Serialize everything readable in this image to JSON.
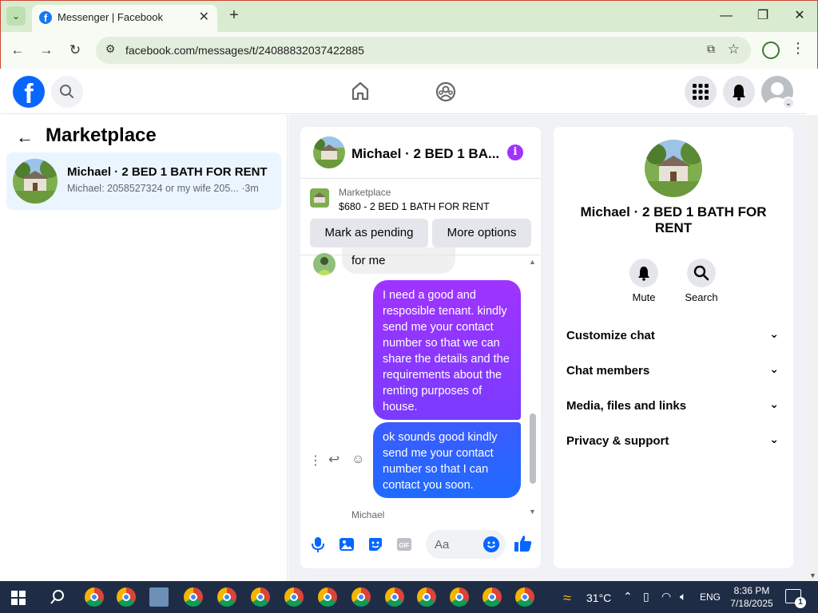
{
  "browser": {
    "tab_title": "Messenger | Facebook",
    "url": "facebook.com/messages/t/24088832037422885",
    "new_tab": "+",
    "close_tab": "✕"
  },
  "window": {
    "minimize": "—",
    "restore": "❐",
    "close": "✕"
  },
  "facebook": {
    "logo_letter": "f",
    "brand_color": "#0866ff"
  },
  "left_panel": {
    "title": "Marketplace",
    "conversation": {
      "name": "Michael · 2 BED 1 BATH FOR RENT",
      "preview": "Michael: 2058527324 or my wife 205...",
      "time": "·3m"
    }
  },
  "chat": {
    "header_name": "Michael · 2 BED 1 BA...",
    "marketplace_label": "Marketplace",
    "listing": "$680 - 2 BED 1 BATH FOR RENT",
    "mark_pending": "Mark as pending",
    "more_options": "More options",
    "messages": [
      {
        "from": "them",
        "text": "for me"
      },
      {
        "from": "me",
        "text": "I need a good and resposible tenant. kindly send me your contact number so that we can share the details and the requirements about the renting purposes of house."
      },
      {
        "from": "me",
        "text": "ok sounds good kindly send me your contact number so that I can contact you soon."
      }
    ],
    "seen_by": "Michael",
    "composer_placeholder": "Aa"
  },
  "right_panel": {
    "name": "Michael · 2 BED 1 BATH FOR RENT",
    "mute": "Mute",
    "search": "Search",
    "rows": [
      "Customize chat",
      "Chat members",
      "Media, files and links",
      "Privacy & support"
    ]
  },
  "taskbar": {
    "temperature": "31°C",
    "language": "ENG",
    "time": "8:36 PM",
    "date": "7/18/2025",
    "notification_count": "1"
  }
}
